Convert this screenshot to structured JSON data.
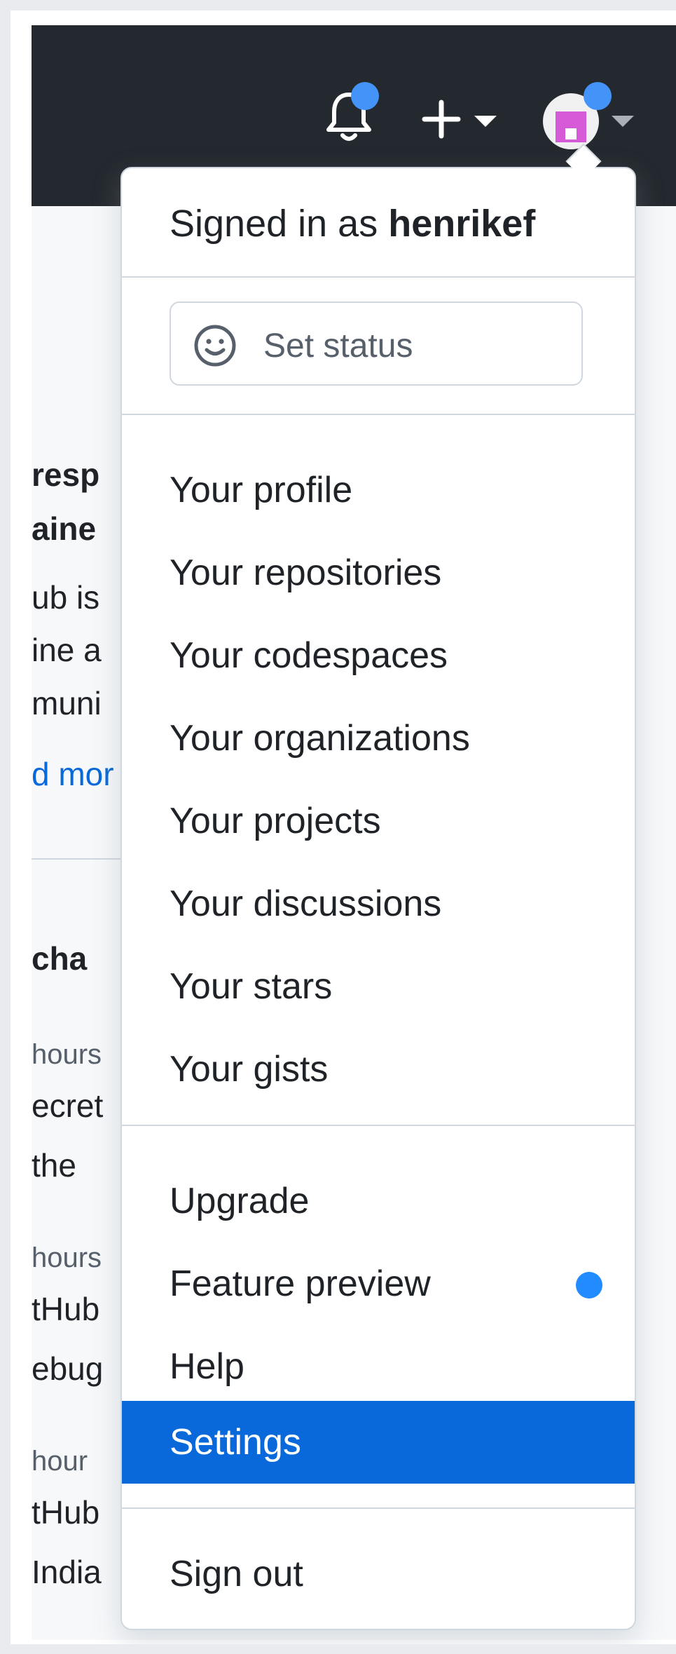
{
  "background_page": {
    "fragments": [
      "resp",
      "aine",
      "ub is",
      "ine a",
      "muni",
      "d mor",
      "cha",
      "hours",
      "ecret",
      "the",
      "hours",
      "tHub",
      "ebug",
      "hour",
      "tHub",
      "India"
    ]
  },
  "header": {
    "icons": [
      "bell-icon",
      "plus-icon",
      "chevron-down-icon",
      "avatar",
      "chevron-down-icon"
    ]
  },
  "menu": {
    "signed_in_prefix": "Signed in as",
    "username": "henrikef",
    "set_status_label": "Set status",
    "profile_items": [
      {
        "label": "Your profile"
      },
      {
        "label": "Your repositories"
      },
      {
        "label": "Your codespaces"
      },
      {
        "label": "Your organizations"
      },
      {
        "label": "Your projects"
      },
      {
        "label": "Your discussions"
      },
      {
        "label": "Your stars"
      },
      {
        "label": "Your gists"
      }
    ],
    "misc_items": [
      {
        "label": "Upgrade"
      },
      {
        "label": "Feature preview"
      },
      {
        "label": "Help"
      },
      {
        "label": "Settings"
      }
    ],
    "sign_out_label": "Sign out",
    "active_item": "Settings"
  },
  "colors": {
    "topbar": "#24292f",
    "accent": "#0969da",
    "notification_dot": "#4493f8",
    "avatar": "#d65ad8"
  }
}
